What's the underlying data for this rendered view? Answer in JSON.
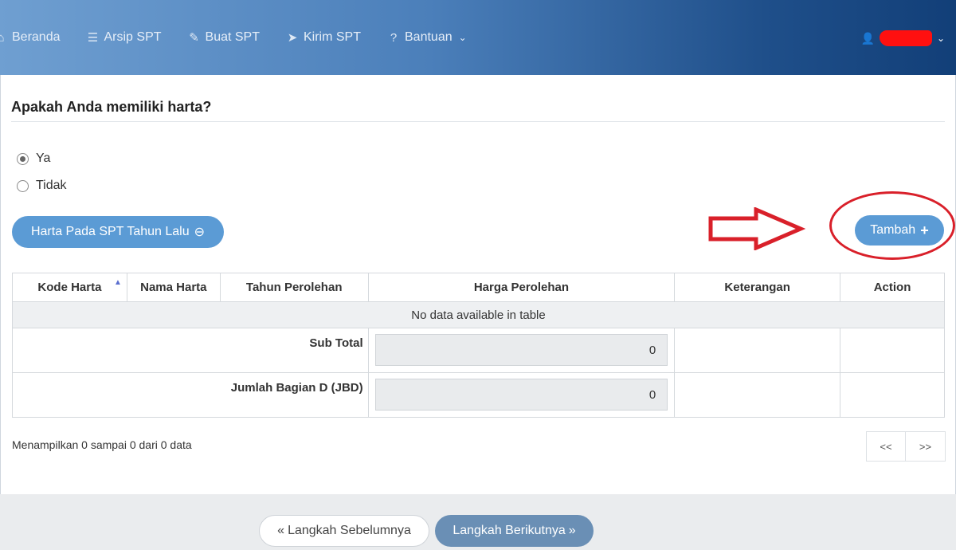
{
  "nav": {
    "items": [
      {
        "label": "Beranda",
        "icon": "home-icon",
        "glyph": "⌂"
      },
      {
        "label": "Arsip SPT",
        "icon": "list-icon",
        "glyph": "☰"
      },
      {
        "label": "Buat SPT",
        "icon": "edit-icon",
        "glyph": "✎"
      },
      {
        "label": "Kirim SPT",
        "icon": "send-icon",
        "glyph": "➤"
      },
      {
        "label": "Bantuan",
        "icon": "question-circle-icon",
        "glyph": "?"
      }
    ],
    "user_icon": "user-icon"
  },
  "question": "Apakah Anda memiliki harta?",
  "options": {
    "yes_label": "Ya",
    "no_label": "Tidak",
    "selected": "Ya"
  },
  "buttons": {
    "prev_year": "Harta Pada SPT Tahun Lalu",
    "tambah": "Tambah",
    "back": "Langkah Sebelumnya",
    "next": "Langkah Berikutnya"
  },
  "table": {
    "columns": [
      "Kode Harta",
      "Nama Harta",
      "Tahun Perolehan",
      "Harga Perolehan",
      "Keterangan",
      "Action"
    ],
    "empty_message": "No data available in table",
    "subtotal_label": "Sub Total",
    "subtotal_value": "0",
    "jumlah_label": "Jumlah Bagian D (JBD)",
    "jumlah_value": "0"
  },
  "pagination": {
    "info": "Menampilkan 0 sampai 0 dari 0 data",
    "prev": "<<",
    "next": ">>"
  },
  "annotation_color": "#d9202a",
  "accent_color": "#5b9bd5"
}
